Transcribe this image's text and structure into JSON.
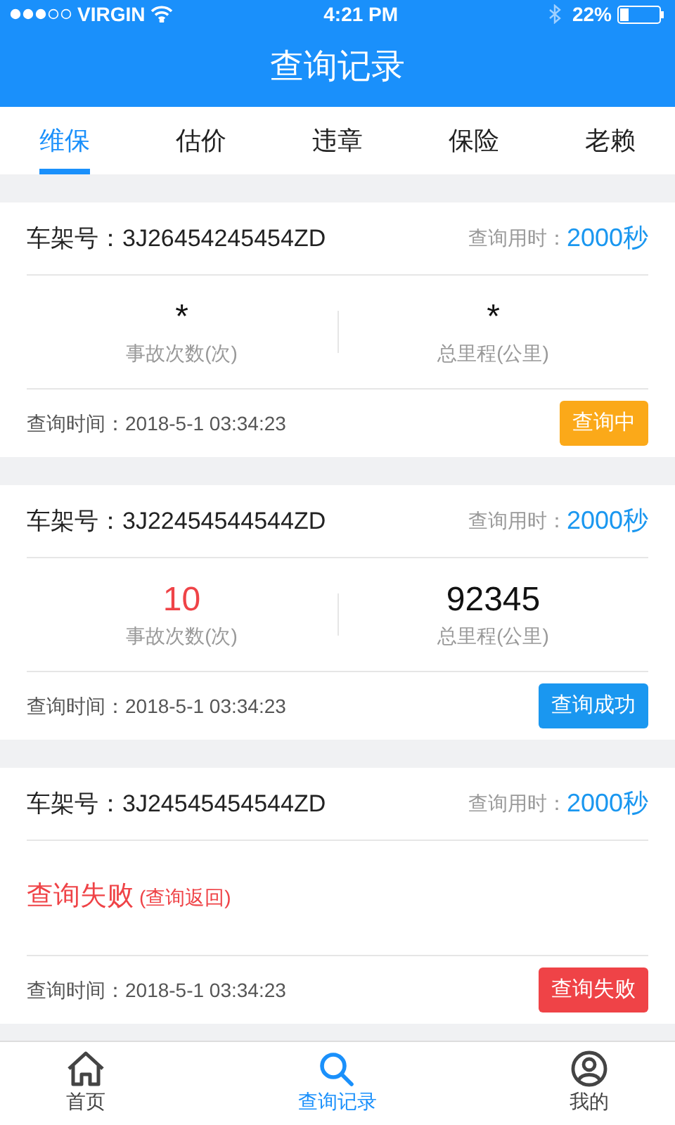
{
  "status_bar": {
    "carrier": "VIRGIN",
    "time": "4:21 PM",
    "battery": "22%"
  },
  "header": {
    "title": "查询记录"
  },
  "tabs": [
    {
      "label": "维保",
      "selected": true
    },
    {
      "label": "估价",
      "selected": false
    },
    {
      "label": "违章",
      "selected": false
    },
    {
      "label": "保险",
      "selected": false
    },
    {
      "label": "老赖",
      "selected": false
    }
  ],
  "records": [
    {
      "kind": "stats",
      "vin_label": "车架号：",
      "vin": "3J26454245454ZD",
      "duration_label": "查询用时：",
      "duration": "2000秒",
      "accidents": "*",
      "accidents_label": "事故次数(次)",
      "accidents_alert": false,
      "mileage": "*",
      "mileage_label": "总里程(公里)",
      "time_label": "查询时间：",
      "time": "2018-5-1 03:34:23",
      "status": {
        "kind": "pending",
        "label": "查询中"
      }
    },
    {
      "kind": "stats",
      "vin_label": "车架号：",
      "vin": "3J22454544544ZD",
      "duration_label": "查询用时：",
      "duration": "2000秒",
      "accidents": "10",
      "accidents_label": "事故次数(次)",
      "accidents_alert": true,
      "mileage": "92345",
      "mileage_label": "总里程(公里)",
      "time_label": "查询时间：",
      "time": "2018-5-1 03:34:23",
      "status": {
        "kind": "success",
        "label": "查询成功"
      }
    },
    {
      "kind": "failed",
      "vin_label": "车架号：",
      "vin": "3J24545454544ZD",
      "duration_label": "查询用时：",
      "duration": "2000秒",
      "message": "查询失败",
      "note": "(查询返回)",
      "time_label": "查询时间：",
      "time": "2018-5-1 03:34:23",
      "status": {
        "kind": "failed",
        "label": "查询失败"
      }
    }
  ],
  "bottom_nav": [
    {
      "label": "首页",
      "kind": "home",
      "selected": false
    },
    {
      "label": "查询记录",
      "kind": "search",
      "selected": true
    },
    {
      "label": "我的",
      "kind": "user",
      "selected": false
    }
  ]
}
